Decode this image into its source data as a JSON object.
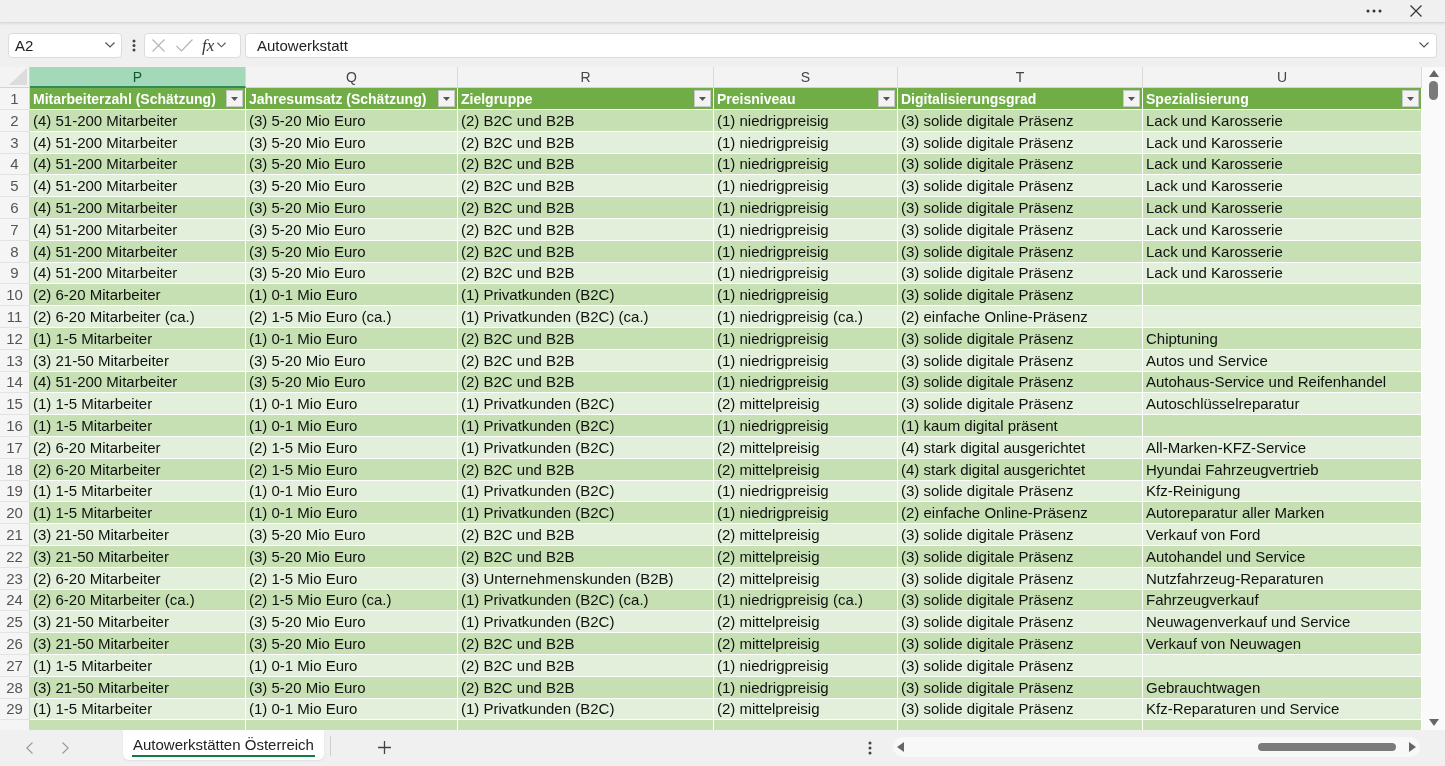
{
  "formula_bar": {
    "name_box": "A2",
    "insert_function": "fx",
    "formula": "Autowerkstatt"
  },
  "sheet": {
    "columns": [
      {
        "letter": "P",
        "header": "Mitarbeiterzahl (Schätzung)",
        "selected": true
      },
      {
        "letter": "Q",
        "header": "Jahresumsatz (Schätzung)",
        "selected": false
      },
      {
        "letter": "R",
        "header": "Zielgruppe",
        "selected": false
      },
      {
        "letter": "S",
        "header": "Preisniveau",
        "selected": false
      },
      {
        "letter": "T",
        "header": "Digitalisierungsgrad",
        "selected": false
      },
      {
        "letter": "U",
        "header": "Spezialisierung",
        "selected": false
      }
    ],
    "header_row_number": "1",
    "rows": [
      {
        "number": "2",
        "employees": "(4) 51-200 Mitarbeiter",
        "revenue": "(3) 5-20 Mio Euro",
        "target_group": "(2) B2C und B2B",
        "price_level": "(1) niedrigpreisig",
        "digitalization": "(3) solide digitale Präsenz",
        "specialization": "Lack und Karosserie"
      },
      {
        "number": "3",
        "employees": "(4) 51-200 Mitarbeiter",
        "revenue": "(3) 5-20 Mio Euro",
        "target_group": "(2) B2C und B2B",
        "price_level": "(1) niedrigpreisig",
        "digitalization": "(3) solide digitale Präsenz",
        "specialization": "Lack und Karosserie"
      },
      {
        "number": "4",
        "employees": "(4) 51-200 Mitarbeiter",
        "revenue": "(3) 5-20 Mio Euro",
        "target_group": "(2) B2C und B2B",
        "price_level": "(1) niedrigpreisig",
        "digitalization": "(3) solide digitale Präsenz",
        "specialization": "Lack und Karosserie"
      },
      {
        "number": "5",
        "employees": "(4) 51-200 Mitarbeiter",
        "revenue": "(3) 5-20 Mio Euro",
        "target_group": "(2) B2C und B2B",
        "price_level": "(1) niedrigpreisig",
        "digitalization": "(3) solide digitale Präsenz",
        "specialization": "Lack und Karosserie"
      },
      {
        "number": "6",
        "employees": "(4) 51-200 Mitarbeiter",
        "revenue": "(3) 5-20 Mio Euro",
        "target_group": "(2) B2C und B2B",
        "price_level": "(1) niedrigpreisig",
        "digitalization": "(3) solide digitale Präsenz",
        "specialization": "Lack und Karosserie"
      },
      {
        "number": "7",
        "employees": "(4) 51-200 Mitarbeiter",
        "revenue": "(3) 5-20 Mio Euro",
        "target_group": "(2) B2C und B2B",
        "price_level": "(1) niedrigpreisig",
        "digitalization": "(3) solide digitale Präsenz",
        "specialization": "Lack und Karosserie"
      },
      {
        "number": "8",
        "employees": "(4) 51-200 Mitarbeiter",
        "revenue": "(3) 5-20 Mio Euro",
        "target_group": "(2) B2C und B2B",
        "price_level": "(1) niedrigpreisig",
        "digitalization": "(3) solide digitale Präsenz",
        "specialization": "Lack und Karosserie"
      },
      {
        "number": "9",
        "employees": "(4) 51-200 Mitarbeiter",
        "revenue": "(3) 5-20 Mio Euro",
        "target_group": "(2) B2C und B2B",
        "price_level": "(1) niedrigpreisig",
        "digitalization": "(3) solide digitale Präsenz",
        "specialization": "Lack und Karosserie"
      },
      {
        "number": "10",
        "employees": "(2) 6-20 Mitarbeiter",
        "revenue": "(1) 0-1 Mio Euro",
        "target_group": "(1) Privatkunden (B2C)",
        "price_level": "(1) niedrigpreisig",
        "digitalization": "(3) solide digitale Präsenz"
      },
      {
        "number": "11",
        "employees": "(2) 6-20 Mitarbeiter (ca.)",
        "revenue": "(2) 1-5 Mio Euro (ca.)",
        "target_group": "(1) Privatkunden (B2C) (ca.)",
        "price_level": "(1) niedrigpreisig (ca.)",
        "digitalization": "(2) einfache Online-Präsenz"
      },
      {
        "number": "12",
        "employees": "(1) 1-5 Mitarbeiter",
        "revenue": "(1) 0-1 Mio Euro",
        "target_group": "(2) B2C und B2B",
        "price_level": "(1) niedrigpreisig",
        "digitalization": "(3) solide digitale Präsenz",
        "specialization": "Chiptuning"
      },
      {
        "number": "13",
        "employees": "(3) 21-50 Mitarbeiter",
        "revenue": "(3) 5-20 Mio Euro",
        "target_group": "(2) B2C und B2B",
        "price_level": "(1) niedrigpreisig",
        "digitalization": "(3) solide digitale Präsenz",
        "specialization": "Autos und Service"
      },
      {
        "number": "14",
        "employees": "(4) 51-200 Mitarbeiter",
        "revenue": "(3) 5-20 Mio Euro",
        "target_group": "(2) B2C und B2B",
        "price_level": "(1) niedrigpreisig",
        "digitalization": "(3) solide digitale Präsenz",
        "specialization": "Autohaus-Service und Reifenhandel"
      },
      {
        "number": "15",
        "employees": "(1) 1-5 Mitarbeiter",
        "revenue": "(1) 0-1 Mio Euro",
        "target_group": "(1) Privatkunden (B2C)",
        "price_level": "(2) mittelpreisig",
        "digitalization": "(3) solide digitale Präsenz",
        "specialization": "Autoschlüsselreparatur"
      },
      {
        "number": "16",
        "employees": "(1) 1-5 Mitarbeiter",
        "revenue": "(1) 0-1 Mio Euro",
        "target_group": "(1) Privatkunden (B2C)",
        "price_level": "(1) niedrigpreisig",
        "digitalization": "(1) kaum digital präsent"
      },
      {
        "number": "17",
        "employees": "(2) 6-20 Mitarbeiter",
        "revenue": "(2) 1-5 Mio Euro",
        "target_group": "(1) Privatkunden (B2C)",
        "price_level": "(2) mittelpreisig",
        "digitalization": "(4) stark digital ausgerichtet",
        "specialization": "All-Marken-KFZ-Service"
      },
      {
        "number": "18",
        "employees": "(2) 6-20 Mitarbeiter",
        "revenue": "(2) 1-5 Mio Euro",
        "target_group": "(2) B2C und B2B",
        "price_level": "(2) mittelpreisig",
        "digitalization": "(4) stark digital ausgerichtet",
        "specialization": "Hyundai Fahrzeugvertrieb"
      },
      {
        "number": "19",
        "employees": "(1) 1-5 Mitarbeiter",
        "revenue": "(1) 0-1 Mio Euro",
        "target_group": "(1) Privatkunden (B2C)",
        "price_level": "(1) niedrigpreisig",
        "digitalization": "(3) solide digitale Präsenz",
        "specialization": "Kfz-Reinigung"
      },
      {
        "number": "20",
        "employees": "(1) 1-5 Mitarbeiter",
        "revenue": "(1) 0-1 Mio Euro",
        "target_group": "(1) Privatkunden (B2C)",
        "price_level": "(1) niedrigpreisig",
        "digitalization": "(2) einfache Online-Präsenz",
        "specialization": "Autoreparatur aller Marken"
      },
      {
        "number": "21",
        "employees": "(3) 21-50 Mitarbeiter",
        "revenue": "(3) 5-20 Mio Euro",
        "target_group": "(2) B2C und B2B",
        "price_level": "(2) mittelpreisig",
        "digitalization": "(3) solide digitale Präsenz",
        "specialization": "Verkauf von Ford"
      },
      {
        "number": "22",
        "employees": "(3) 21-50 Mitarbeiter",
        "revenue": "(3) 5-20 Mio Euro",
        "target_group": "(2) B2C und B2B",
        "price_level": "(2) mittelpreisig",
        "digitalization": "(3) solide digitale Präsenz",
        "specialization": "Autohandel und Service"
      },
      {
        "number": "23",
        "employees": "(2) 6-20 Mitarbeiter",
        "revenue": "(2) 1-5 Mio Euro",
        "target_group": "(3) Unternehmenskunden (B2B)",
        "price_level": "(2) mittelpreisig",
        "digitalization": "(3) solide digitale Präsenz",
        "specialization": "Nutzfahrzeug-Reparaturen"
      },
      {
        "number": "24",
        "employees": "(2) 6-20 Mitarbeiter (ca.)",
        "revenue": "(2) 1-5 Mio Euro (ca.)",
        "target_group": "(1) Privatkunden (B2C) (ca.)",
        "price_level": "(1) niedrigpreisig (ca.)",
        "digitalization": "(3) solide digitale Präsenz",
        "specialization": "Fahrzeugverkauf"
      },
      {
        "number": "25",
        "employees": "(3) 21-50 Mitarbeiter",
        "revenue": "(3) 5-20 Mio Euro",
        "target_group": "(1) Privatkunden (B2C)",
        "price_level": "(2) mittelpreisig",
        "digitalization": "(3) solide digitale Präsenz",
        "specialization": "Neuwagenverkauf und Service"
      },
      {
        "number": "26",
        "employees": "(3) 21-50 Mitarbeiter",
        "revenue": "(3) 5-20 Mio Euro",
        "target_group": "(2) B2C und B2B",
        "price_level": "(2) mittelpreisig",
        "digitalization": "(3) solide digitale Präsenz",
        "specialization": "Verkauf von Neuwagen"
      },
      {
        "number": "27",
        "employees": "(1) 1-5 Mitarbeiter",
        "revenue": "(1) 0-1 Mio Euro",
        "target_group": "(2) B2C und B2B",
        "price_level": "(1) niedrigpreisig",
        "digitalization": "(3) solide digitale Präsenz"
      },
      {
        "number": "28",
        "employees": "(3) 21-50 Mitarbeiter",
        "revenue": "(3) 5-20 Mio Euro",
        "target_group": "(2) B2C und B2B",
        "price_level": "(1) niedrigpreisig",
        "digitalization": "(3) solide digitale Präsenz",
        "specialization": "Gebrauchtwagen"
      },
      {
        "number": "29",
        "employees": "(1) 1-5 Mitarbeiter",
        "revenue": "(1) 0-1 Mio Euro",
        "target_group": "(1) Privatkunden (B2C)",
        "price_level": "(2) mittelpreisig",
        "digitalization": "(3) solide digitale Präsenz",
        "specialization": "Kfz-Reparaturen und Service"
      }
    ]
  },
  "sheet_tabs": [
    {
      "label": "Autowerkstätten Österreich",
      "selected": true
    }
  ]
}
